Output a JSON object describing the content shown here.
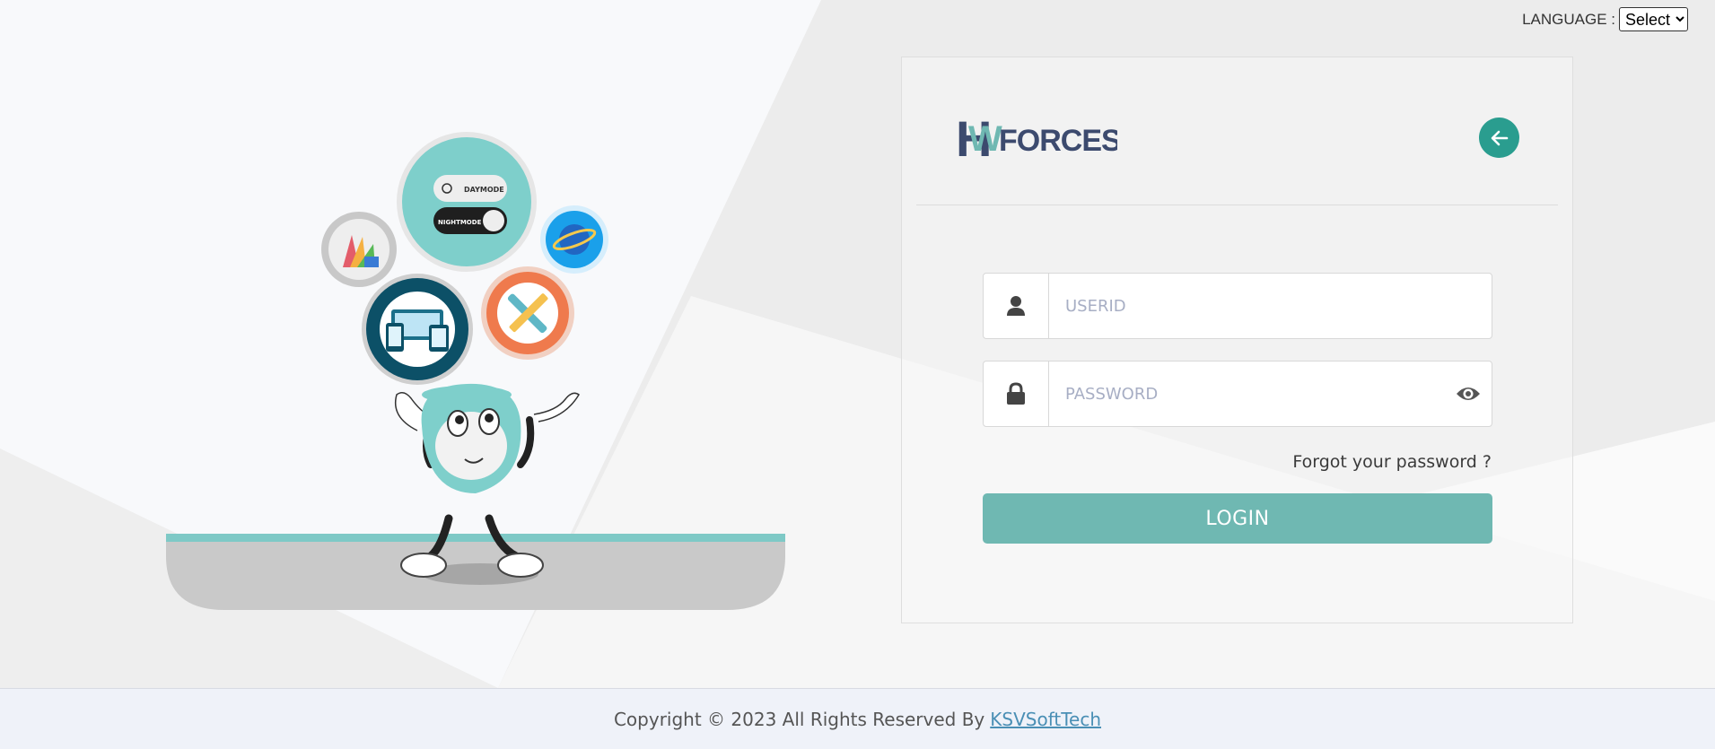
{
  "language": {
    "label": "LANGUAGE :",
    "selected": "Select"
  },
  "logo": {
    "text_h": "H",
    "text_w": "W",
    "text_forces": "FORCES"
  },
  "illustration": {
    "day_mode_label": "DAYMODE",
    "night_mode_label": "NIGHTMODE"
  },
  "login_form": {
    "userid_placeholder": "USERID",
    "password_placeholder": "PASSWORD",
    "forgot_label": "Forgot your password ?",
    "login_label": "LOGIN"
  },
  "footer": {
    "copyright": "Copyright © 2023 All Rights Reserved By",
    "company_link": "KSVSoftTech"
  },
  "colors": {
    "accent": "#2a9d8f",
    "login_button": "#6fb8b2",
    "logo_navy": "#3c4a6e",
    "logo_teal": "#6fb8b2"
  },
  "icons": [
    "user-icon",
    "lock-icon",
    "eye-icon",
    "arrow-left-icon"
  ]
}
